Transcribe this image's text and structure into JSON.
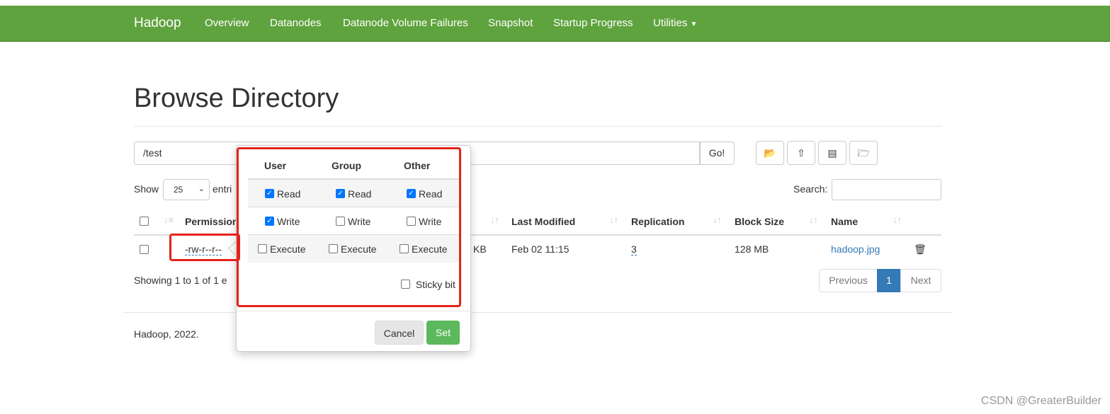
{
  "nav": {
    "brand": "Hadoop",
    "items": [
      "Overview",
      "Datanodes",
      "Datanode Volume Failures",
      "Snapshot",
      "Startup Progress",
      "Utilities"
    ]
  },
  "page": {
    "title": "Browse Directory",
    "path": "/test",
    "go": "Go!",
    "show": "Show",
    "entries_size": "25",
    "entries": "entri",
    "search": "Search:"
  },
  "table": {
    "headers": [
      "Permission",
      "Last Modified",
      "Replication",
      "Block Size",
      "Name"
    ],
    "row": {
      "permission": "-rw-r--r--",
      "size_fragment": "KB",
      "modified": "Feb 02 11:15",
      "replication": "3",
      "block_size": "128 MB",
      "name": "hadoop.jpg"
    },
    "info": "Showing 1 to 1 of 1 e"
  },
  "pagination": {
    "prev": "Previous",
    "current": "1",
    "next": "Next"
  },
  "popover": {
    "cols": [
      "User",
      "Group",
      "Other"
    ],
    "read": "Read",
    "write": "Write",
    "execute": "Execute",
    "sticky": "Sticky bit",
    "cancel": "Cancel",
    "set": "Set",
    "checked": {
      "read": [
        true,
        true,
        true
      ],
      "write": [
        true,
        false,
        false
      ],
      "execute": [
        false,
        false,
        false
      ],
      "sticky": false
    }
  },
  "footer": "Hadoop, 2022.",
  "watermark": "CSDN @GreaterBuilder",
  "colors": {
    "navbar": "#5fa33e",
    "primary": "#337ab7",
    "success": "#5cb85c",
    "annotation": "#e5231b"
  }
}
